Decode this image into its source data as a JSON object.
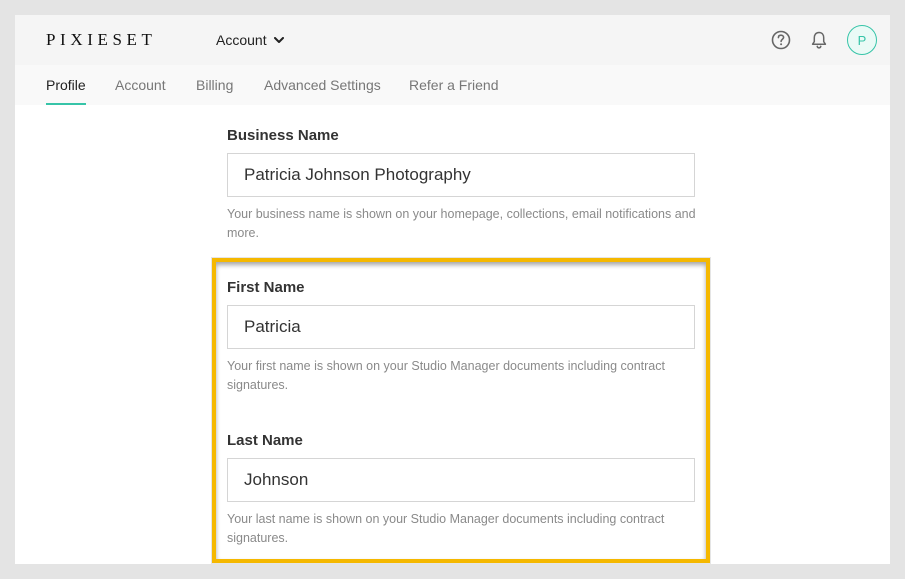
{
  "header": {
    "logo": "PIXIESET",
    "account_menu_label": "Account",
    "avatar_initial": "P"
  },
  "tabs": [
    {
      "label": "Profile",
      "active": true
    },
    {
      "label": "Account",
      "active": false
    },
    {
      "label": "Billing",
      "active": false
    },
    {
      "label": "Advanced Settings",
      "active": false
    },
    {
      "label": "Refer a Friend",
      "active": false
    }
  ],
  "form": {
    "business_name": {
      "label": "Business Name",
      "value": "Patricia Johnson Photography",
      "help": "Your business name is shown on your homepage, collections, email notifications and more."
    },
    "first_name": {
      "label": "First Name",
      "value": "Patricia",
      "help": "Your first name is shown on your Studio Manager documents including contract signatures."
    },
    "last_name": {
      "label": "Last Name",
      "value": "Johnson",
      "help": "Your last name is shown on your Studio Manager documents including contract signatures."
    }
  },
  "colors": {
    "accent": "#36c4a8",
    "highlight": "#f5b800"
  },
  "icons": [
    "help-circle-icon",
    "bell-icon",
    "chevron-down-icon"
  ]
}
